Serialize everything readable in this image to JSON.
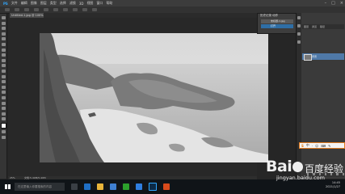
{
  "app": {
    "menu_items": [
      "PS",
      "文件",
      "编辑",
      "图像",
      "图层",
      "类型",
      "选择",
      "滤镜",
      "3D",
      "视图",
      "窗口",
      "帮助"
    ],
    "window_controls": [
      "–",
      "□",
      "×"
    ]
  },
  "document": {
    "tab_title": "Untitled-1.jpg @ 100%",
    "zoom": "25%",
    "doc_info": "文档:5.49M/5.49M"
  },
  "history_panel": {
    "title": "历史记录  动作",
    "snapshot_label": "未标题-1.jpg",
    "step_label": "打开"
  },
  "layers_panel": {
    "tabs": [
      "图层",
      "通道",
      "路径"
    ],
    "layer_name": "背景"
  },
  "ime_bar": {
    "label": "S",
    "items": [
      "中",
      "·",
      "☺",
      "⌨",
      "✎"
    ]
  },
  "taskbar": {
    "search_placeholder": "在这里输入你要搜索的内容",
    "time": "14:45",
    "date": "2021/1/27"
  },
  "watermark": {
    "logo_text_a": "Bai",
    "logo_text_b": "百度",
    "logo_suffix": "经验",
    "sub_text": "jingyan.baidu.com"
  },
  "colors": {
    "accent": "#2f6ea5",
    "layer_selected": "#4f79a8",
    "app_bg": "#262626"
  }
}
